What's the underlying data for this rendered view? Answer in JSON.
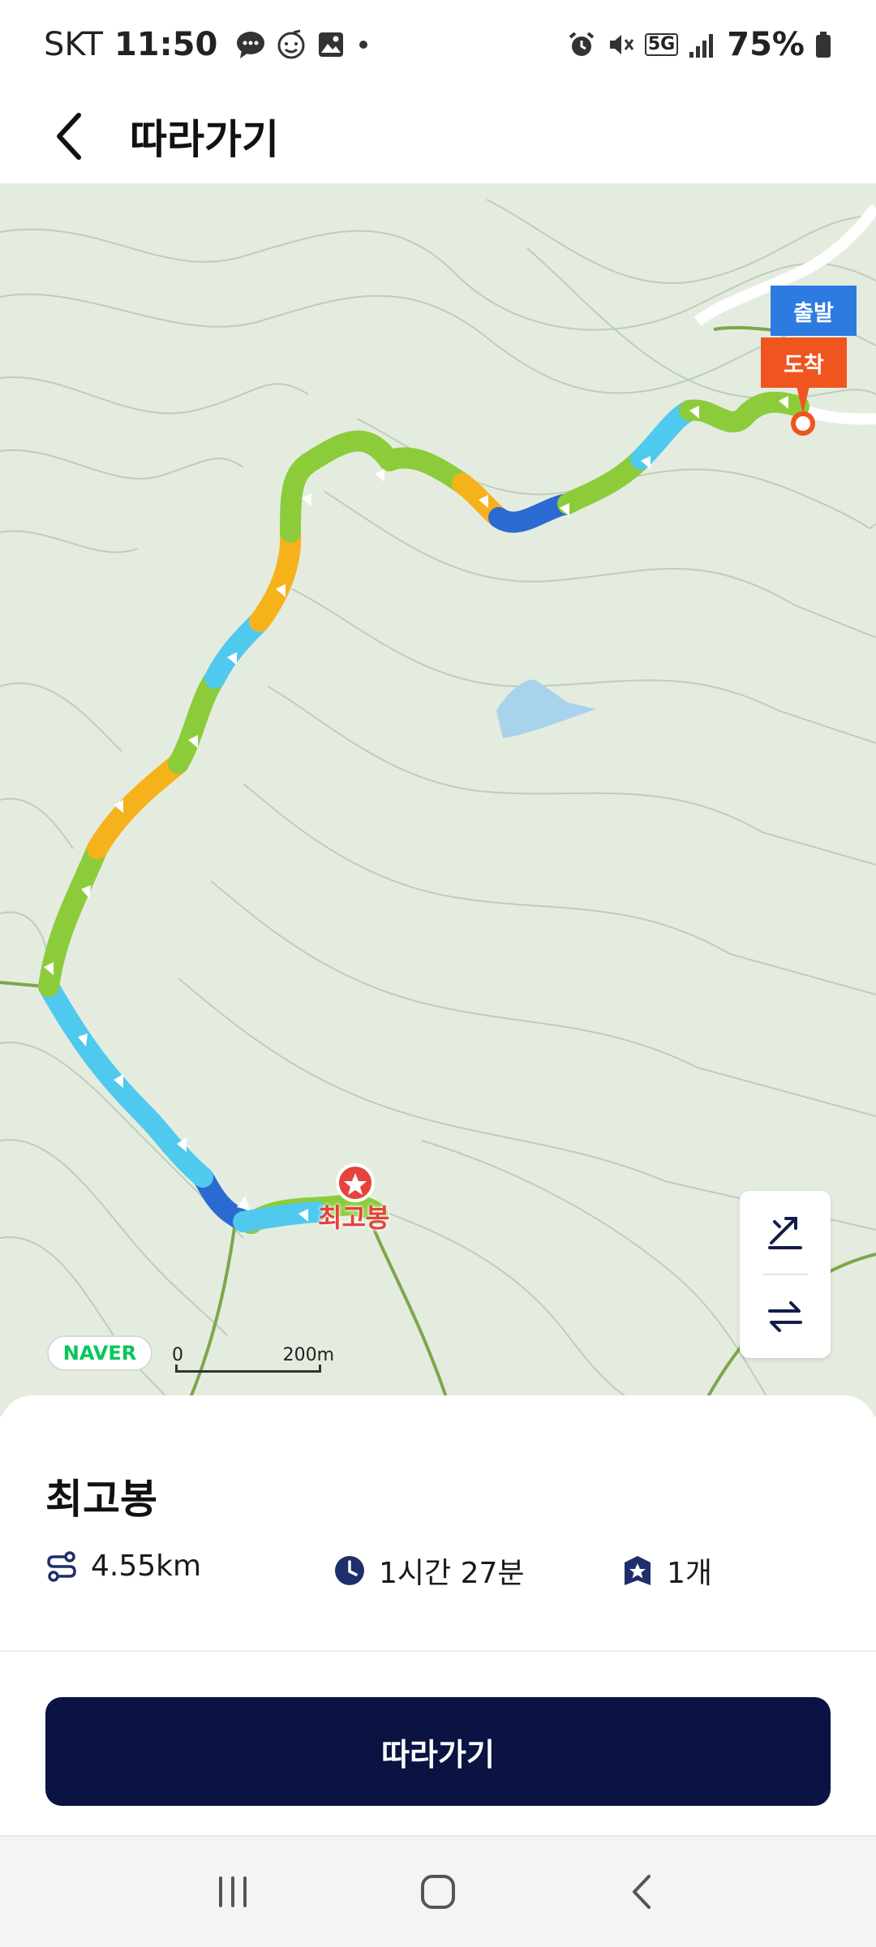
{
  "status_bar": {
    "carrier": "SKT",
    "time": "11:50",
    "network": "5G",
    "battery": "75%"
  },
  "header": {
    "title": "따라가기",
    "back_icon": "chevron-left-icon"
  },
  "map": {
    "start_label": "출발",
    "end_label": "도착",
    "peak_label": "최고봉",
    "provider": "NAVER",
    "scale_zero": "0",
    "scale_distance": "200m",
    "tools": [
      "slope-toggle-icon",
      "swap-direction-icon"
    ],
    "colors": {
      "terrain": "#e4ece0",
      "contour": "#b5c8b0",
      "route_green": "#8ccc3a",
      "route_cyan": "#4fc9ee",
      "route_blue": "#2a6ad1",
      "route_orange": "#f6b21a",
      "start_blue": "#2d7be0",
      "end_orange": "#f0541f"
    }
  },
  "course": {
    "name": "최고봉",
    "distance": "4.55km",
    "duration": "1시간 27분",
    "peak_count": "1개"
  },
  "actions": {
    "follow_label": "따라가기",
    "accent": "#0a1342"
  },
  "nav_bar": {
    "buttons": [
      "recent-apps-icon",
      "home-icon",
      "back-icon"
    ]
  }
}
